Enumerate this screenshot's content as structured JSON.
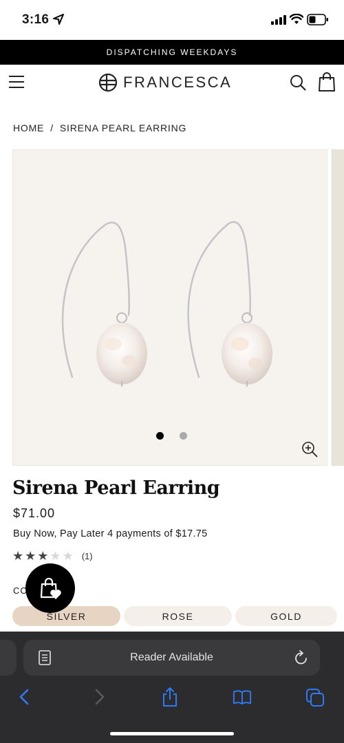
{
  "status": {
    "time": "3:16"
  },
  "announcement": "DISPATCHING WEEKDAYS",
  "header": {
    "brand": "FRANCESCA"
  },
  "breadcrumb": {
    "home": "HOME",
    "separator": "/",
    "current": "SIRENA PEARL EARRING"
  },
  "gallery": {
    "slide_count": 2,
    "active_slide": 1
  },
  "product": {
    "title": "Sirena Pearl Earring",
    "price": "$71.00",
    "bnpl": "Buy Now, Pay Later 4 payments of $17.75",
    "rating": {
      "value": 3,
      "max": 5,
      "count_label": "(1)"
    },
    "color_label": "CO",
    "colors": [
      "SILVER",
      "ROSE",
      "GOLD"
    ],
    "selected_color": "SILVER"
  },
  "browser": {
    "address_text": "Reader Available"
  },
  "colors": {
    "announcement_bg": "#000000",
    "gallery_bg": "#f6f3ef",
    "swatch_selected": "#e8d4c2",
    "swatch_default": "#f4efe9",
    "browser_bar": "#2c2c2e",
    "browser_accent": "#2f7bf6"
  }
}
